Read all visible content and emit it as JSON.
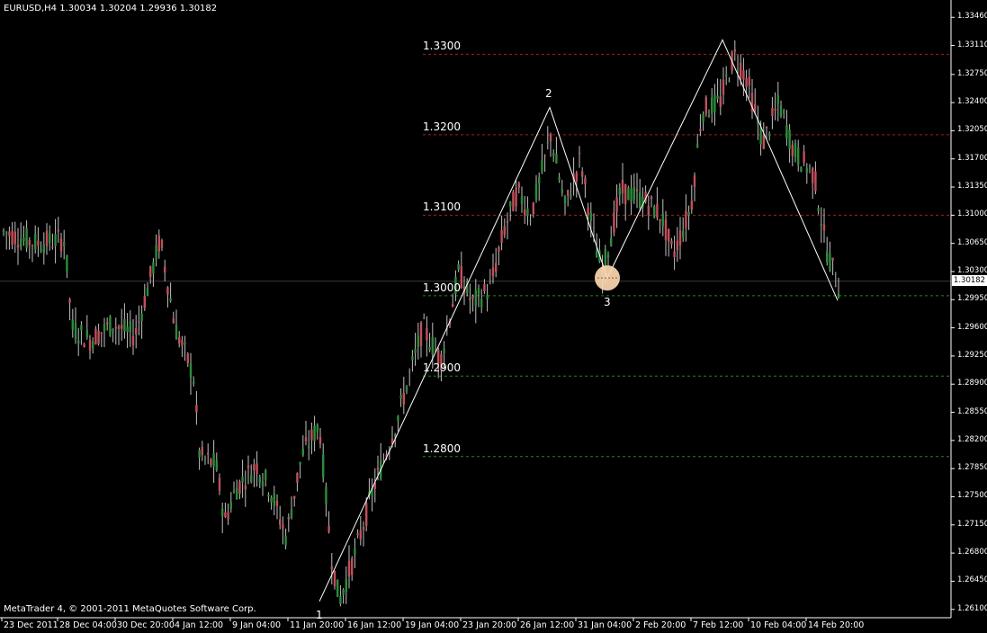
{
  "header": {
    "symbol_info": "EURUSD,H4  1.30034 1.30204 1.29936 1.30182"
  },
  "footer": {
    "copyright": "MetaTrader 4, © 2001-2011 MetaQuotes Software Corp."
  },
  "chart_data": {
    "type": "candlestick",
    "symbol": "EURUSD",
    "timeframe": "H4",
    "ohlc_header": {
      "open": 1.30034,
      "high": 1.30204,
      "low": 1.29936,
      "close": 1.30182
    },
    "current_price": "1.30182",
    "ylim": [
      1.2603,
      1.3353
    ],
    "y_ticks": [
      "1.33460",
      "1.33110",
      "1.32750",
      "1.32400",
      "1.32050",
      "1.31700",
      "1.31350",
      "1.31000",
      "1.30650",
      "1.30300",
      "1.29950",
      "1.29600",
      "1.29250",
      "1.28900",
      "1.28550",
      "1.28200",
      "1.27850",
      "1.27500",
      "1.27150",
      "1.26800",
      "1.26450",
      "1.26100"
    ],
    "x_ticks": [
      "23 Dec 2011",
      "28 Dec 04:00",
      "30 Dec 20:00",
      "4 Jan 12:00",
      "9 Jan 04:00",
      "11 Jan 20:00",
      "16 Jan 12:00",
      "19 Jan 04:00",
      "23 Jan 20:00",
      "26 Jan 12:00",
      "31 Jan 04:00",
      "2 Feb 20:00",
      "7 Feb 12:00",
      "10 Feb 04:00",
      "14 Feb 20:00"
    ],
    "horizontal_levels": [
      {
        "label": "1.3300",
        "value": 1.33,
        "color": "#a0201c"
      },
      {
        "label": "1.3200",
        "value": 1.32,
        "color": "#a0201c"
      },
      {
        "label": "1.3100",
        "value": 1.31,
        "color": "#a0201c"
      },
      {
        "label": "1.3000",
        "value": 1.3,
        "color": "#1f8a1f"
      },
      {
        "label": "1.2900",
        "value": 1.29,
        "color": "#1f8a1f"
      },
      {
        "label": "1.2800",
        "value": 1.28,
        "color": "#1f8a1f"
      }
    ],
    "wave_labels": [
      {
        "label": "1",
        "price": 1.262
      },
      {
        "label": "2",
        "price": 1.3234
      },
      {
        "label": "3",
        "price": 1.3022
      }
    ],
    "anchor_points": [
      {
        "x_tick": "11 Jan 20:00",
        "price": 1.262
      },
      {
        "x_tick": "26 Jan 12:00",
        "price": 1.3234
      },
      {
        "x_tick": "31 Jan 04:00",
        "price": 1.3022
      },
      {
        "x_tick": "7 Feb 12:00",
        "price": 1.3318
      },
      {
        "x_tick": "14 Feb 20:00",
        "price": 1.2994
      }
    ],
    "colors": {
      "background": "#000000",
      "bull_candle": "#2e8b3a",
      "bear_candle": "#c0505a",
      "wick": "#bfbfbf",
      "wave_line": "#ffffff",
      "text": "#ffffff",
      "axis": "#ffffff",
      "highlight": "#fcd7b0"
    }
  }
}
